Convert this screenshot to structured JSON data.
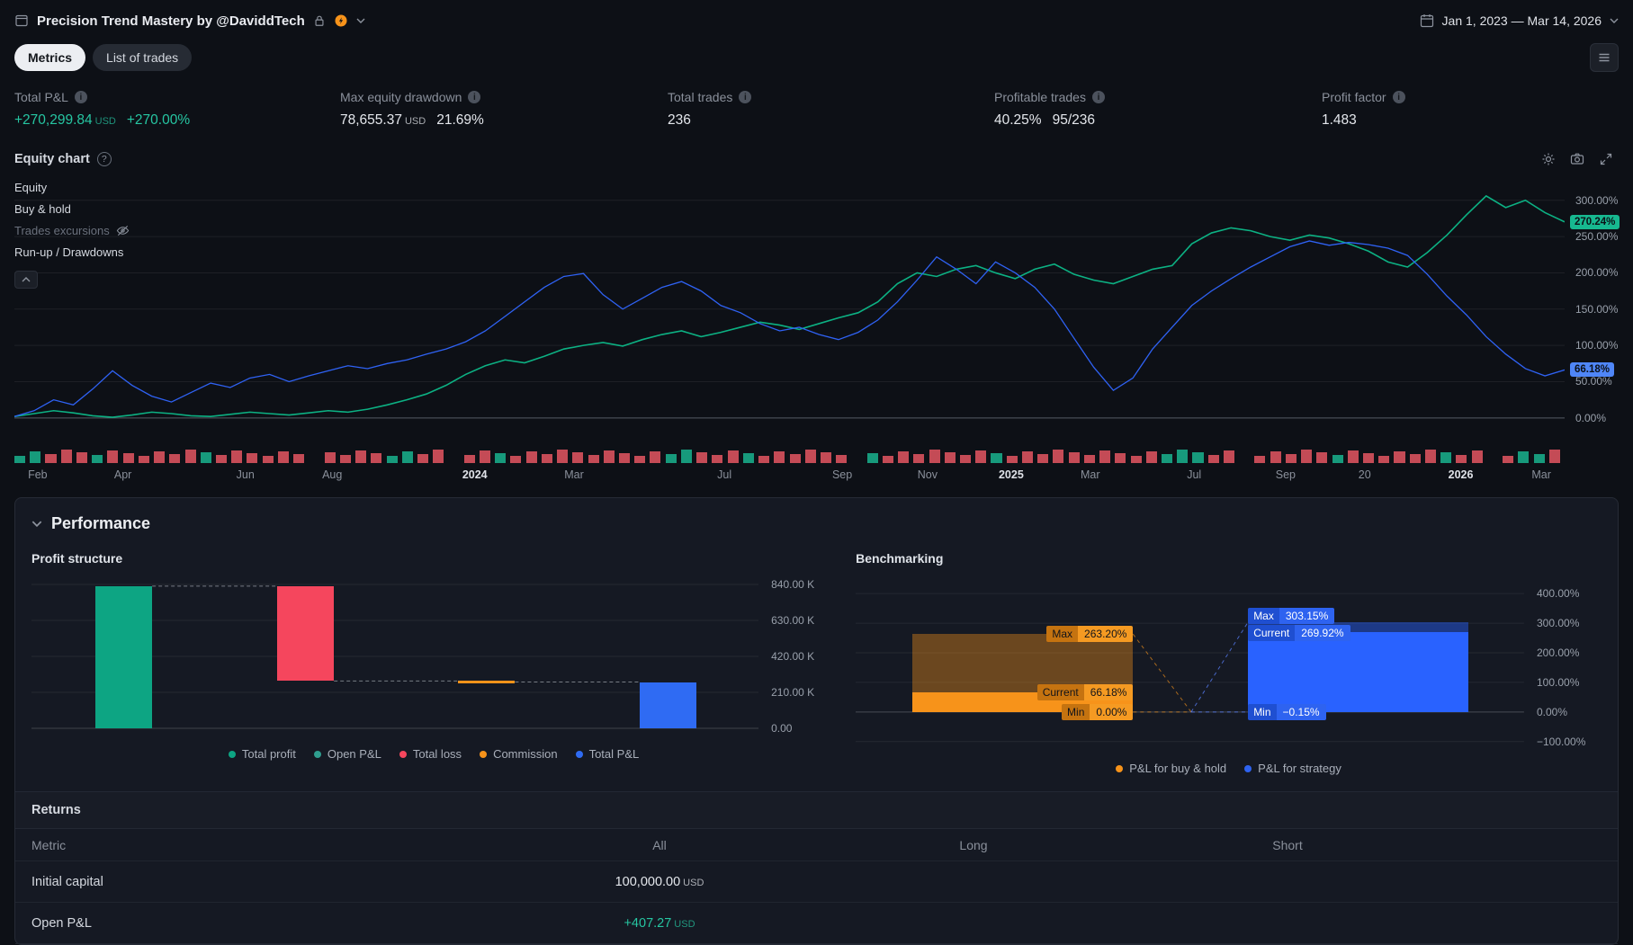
{
  "icons": {
    "info": "i",
    "help": "?"
  },
  "header": {
    "title": "Precision Trend Mastery by @DaviddTech",
    "date_range": "Jan 1, 2023 — Mar 14, 2026"
  },
  "tabs": [
    {
      "label": "Metrics",
      "active": true
    },
    {
      "label": "List of trades",
      "active": false
    }
  ],
  "metrics": [
    {
      "label": "Total P&L",
      "value": "+270,299.84",
      "unit": "USD",
      "extra": "+270.00%",
      "color": "#26c6a2"
    },
    {
      "label": "Max equity drawdown",
      "value": "78,655.37",
      "unit": "USD",
      "extra": "21.69%",
      "color": "#e4e7ec"
    },
    {
      "label": "Total trades",
      "value": "236",
      "unit": "",
      "extra": "",
      "color": "#e4e7ec"
    },
    {
      "label": "Profitable trades",
      "value": "40.25%",
      "unit": "",
      "extra": "95/236",
      "color": "#e4e7ec"
    },
    {
      "label": "Profit factor",
      "value": "1.483",
      "unit": "",
      "extra": "",
      "color": "#e4e7ec"
    }
  ],
  "equity_section": {
    "title": "Equity chart",
    "legend_items": [
      {
        "label": "Equity",
        "muted": false,
        "eye": false
      },
      {
        "label": "Buy & hold",
        "muted": false,
        "eye": false
      },
      {
        "label": "Trades excursions",
        "muted": true,
        "eye": true
      },
      {
        "label": "Run-up / Drawdowns",
        "muted": false,
        "eye": false
      }
    ],
    "badges": [
      {
        "v": 270.24,
        "t": "270.24%",
        "bg": "#17b890"
      },
      {
        "v": 66.18,
        "t": "66.18%",
        "bg": "#4f86f7"
      }
    ],
    "x_ticks": [
      {
        "t": "Feb",
        "p": 0.015
      },
      {
        "t": "Apr",
        "p": 0.07
      },
      {
        "t": "Jun",
        "p": 0.149
      },
      {
        "t": "Aug",
        "p": 0.205
      },
      {
        "t": "2024",
        "p": 0.297,
        "bold": true
      },
      {
        "t": "Mar",
        "p": 0.361
      },
      {
        "t": "Jul",
        "p": 0.458
      },
      {
        "t": "Sep",
        "p": 0.534
      },
      {
        "t": "Nov",
        "p": 0.589
      },
      {
        "t": "2025",
        "p": 0.643,
        "bold": true
      },
      {
        "t": "Mar",
        "p": 0.694
      },
      {
        "t": "Jul",
        "p": 0.761
      },
      {
        "t": "Sep",
        "p": 0.82
      },
      {
        "t": "20",
        "p": 0.871
      },
      {
        "t": "2026",
        "p": 0.933,
        "bold": true
      },
      {
        "t": "Mar",
        "p": 0.985
      }
    ],
    "trade_strip": "ggrrrgrrrrrrgrrrrrr.rrrrggrr.rrgrrrrrrrrrrggrrrgrrrrrr.grrrrrrrgrrrrrrrrrrgggrr.rrrrrgrrrrrrgrr.rggr",
    "strip_colors": {
      "r": "#c44b56",
      "g": "#179a7c"
    }
  },
  "chart_data": [
    {
      "type": "line",
      "title": "Equity chart",
      "x_range": "Jan 2023 – Mar 2026",
      "unit": "%",
      "y_ticks": [
        {
          "v": 300,
          "t": "300.00%"
        },
        {
          "v": 250,
          "t": "250.00%"
        },
        {
          "v": 200,
          "t": "200.00%"
        },
        {
          "v": 150,
          "t": "150.00%"
        },
        {
          "v": 100,
          "t": "100.00%"
        },
        {
          "v": 50,
          "t": "50.00%"
        },
        {
          "v": 0,
          "t": "0.00%"
        }
      ],
      "series": [
        {
          "name": "Equity",
          "color": "#0cb183",
          "final_label": "270.24%",
          "values": [
            2,
            6,
            10,
            7,
            3,
            1,
            4,
            8,
            6,
            3,
            2,
            5,
            8,
            6,
            4,
            7,
            10,
            8,
            12,
            18,
            25,
            33,
            45,
            60,
            72,
            80,
            76,
            85,
            95,
            100,
            104,
            99,
            108,
            115,
            120,
            112,
            118,
            125,
            132,
            128,
            122,
            130,
            138,
            145,
            160,
            185,
            200,
            195,
            205,
            210,
            200,
            192,
            205,
            212,
            198,
            190,
            185,
            195,
            205,
            210,
            240,
            255,
            262,
            258,
            250,
            245,
            252,
            248,
            240,
            230,
            215,
            208,
            228,
            252,
            280,
            306,
            290,
            300,
            283,
            270.24
          ]
        },
        {
          "name": "Buy & hold",
          "color": "#2f62f4",
          "final_label": "66.18%",
          "values": [
            2,
            10,
            25,
            18,
            40,
            65,
            45,
            30,
            22,
            35,
            48,
            42,
            55,
            60,
            50,
            58,
            65,
            72,
            68,
            75,
            80,
            88,
            95,
            105,
            120,
            140,
            160,
            180,
            195,
            199,
            170,
            150,
            165,
            180,
            188,
            175,
            155,
            145,
            130,
            120,
            125,
            115,
            108,
            118,
            135,
            160,
            190,
            222,
            205,
            185,
            215,
            200,
            180,
            150,
            110,
            70,
            38,
            55,
            95,
            125,
            155,
            175,
            192,
            208,
            222,
            236,
            244,
            238,
            242,
            239,
            234,
            224,
            198,
            168,
            142,
            112,
            88,
            68,
            58,
            66.18
          ]
        }
      ]
    },
    {
      "type": "bar",
      "title": "Profit structure",
      "categories": [
        "Total profit",
        "Open P&L",
        "Total loss",
        "Commission",
        "Total P&L"
      ],
      "values": [
        829900,
        407.27,
        -553900,
        -5800,
        270299.84
      ],
      "ylabel": "USD",
      "ymax": 840000,
      "y_ticks": [
        {
          "v": 840000,
          "t": "840.00 K"
        },
        {
          "v": 630000,
          "t": "630.00 K"
        },
        {
          "v": 420000,
          "t": "420.00 K"
        },
        {
          "v": 210000,
          "t": "210.00 K"
        },
        {
          "v": 0,
          "t": "0.00"
        }
      ]
    },
    {
      "type": "range",
      "title": "Benchmarking",
      "ylim": [
        -100,
        400
      ],
      "y_ticks": [
        {
          "v": 400,
          "t": "400.00%"
        },
        {
          "v": 300,
          "t": "300.00%"
        },
        {
          "v": 200,
          "t": "200.00%"
        },
        {
          "v": 100,
          "t": "100.00%"
        },
        {
          "v": 0,
          "t": "0.00%"
        },
        {
          "v": -100,
          "t": "−100.00%"
        }
      ],
      "series": [
        {
          "name": "P&L for buy & hold",
          "max": 263.2,
          "current": 66.18,
          "min": 0.0
        },
        {
          "name": "P&L for strategy",
          "max": 303.15,
          "current": 269.92,
          "min": -0.15
        }
      ]
    }
  ],
  "performance": {
    "title": "Performance",
    "profit_structure": {
      "title": "Profit structure",
      "bar_colors": {
        "profit": "#0da583",
        "loss": "#f5465d",
        "commission": "#f7931a",
        "total": "#2f6bf3"
      },
      "legend": [
        {
          "label": "Total profit",
          "color": "#0da583"
        },
        {
          "label": "Open P&L",
          "color": "#2f9e8f"
        },
        {
          "label": "Total loss",
          "color": "#f5465d"
        },
        {
          "label": "Commission",
          "color": "#f7931a"
        },
        {
          "label": "Total P&L",
          "color": "#2f6bf3"
        }
      ]
    },
    "benchmarking": {
      "title": "Benchmarking",
      "legend": [
        {
          "label": "P&L for buy & hold",
          "color": "#f7931a"
        },
        {
          "label": "P&L for strategy",
          "color": "#2e63f0"
        }
      ],
      "orange_chips": [
        {
          "name": "Max",
          "value": "263.20%"
        },
        {
          "name": "Current",
          "value": "66.18%"
        },
        {
          "name": "Min",
          "value": "0.00%"
        }
      ],
      "blue_chips": [
        {
          "name": "Max",
          "value": "303.15%"
        },
        {
          "name": "Current",
          "value": "269.92%"
        },
        {
          "name": "Min",
          "value": "−0.15%"
        }
      ]
    },
    "returns": {
      "title": "Returns",
      "columns": [
        "Metric",
        "All",
        "Long",
        "Short"
      ],
      "rows": [
        {
          "metric": "Initial capital",
          "all": "100,000.00",
          "unit": "USD",
          "color": "#e4e7ec"
        },
        {
          "metric": "Open P&L",
          "all": "+407.27",
          "unit": "USD",
          "color": "#26c6a2"
        }
      ]
    }
  }
}
